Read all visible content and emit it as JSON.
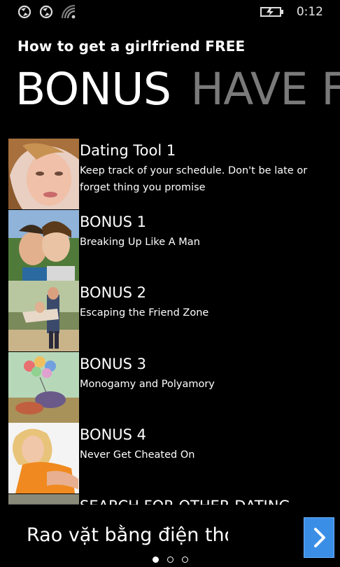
{
  "status_bar": {
    "time": "0:12",
    "icons": [
      "sync-icon",
      "sync-icon",
      "wifi-icon",
      "battery-charging-icon"
    ]
  },
  "app": {
    "title": "How to get a girlfriend FREE"
  },
  "pivot": {
    "active": "BONUS",
    "next": "HAVE F"
  },
  "list": {
    "items": [
      {
        "title": "Dating Tool 1",
        "subtitle": "Keep track of your schedule. Don't be late or forget thing you promise"
      },
      {
        "title": "BONUS 1",
        "subtitle": "Breaking Up Like A Man"
      },
      {
        "title": "BONUS 2",
        "subtitle": "Escaping the Friend Zone"
      },
      {
        "title": "BONUS 3",
        "subtitle": "Monogamy and Polyamory"
      },
      {
        "title": "BONUS 4",
        "subtitle": "Never Get Cheated On"
      },
      {
        "title": "SEARCH FOR OTHER DATING",
        "subtitle": ""
      }
    ]
  },
  "ad": {
    "text": "Rao vặt bằng điện thoại",
    "button_icon": "chevron-right-icon"
  },
  "pager": {
    "count": 3,
    "active": 0
  },
  "colors": {
    "background": "#000000",
    "inactive_pivot": "#7a7a7a",
    "ad_button": "#3a8ee6"
  }
}
